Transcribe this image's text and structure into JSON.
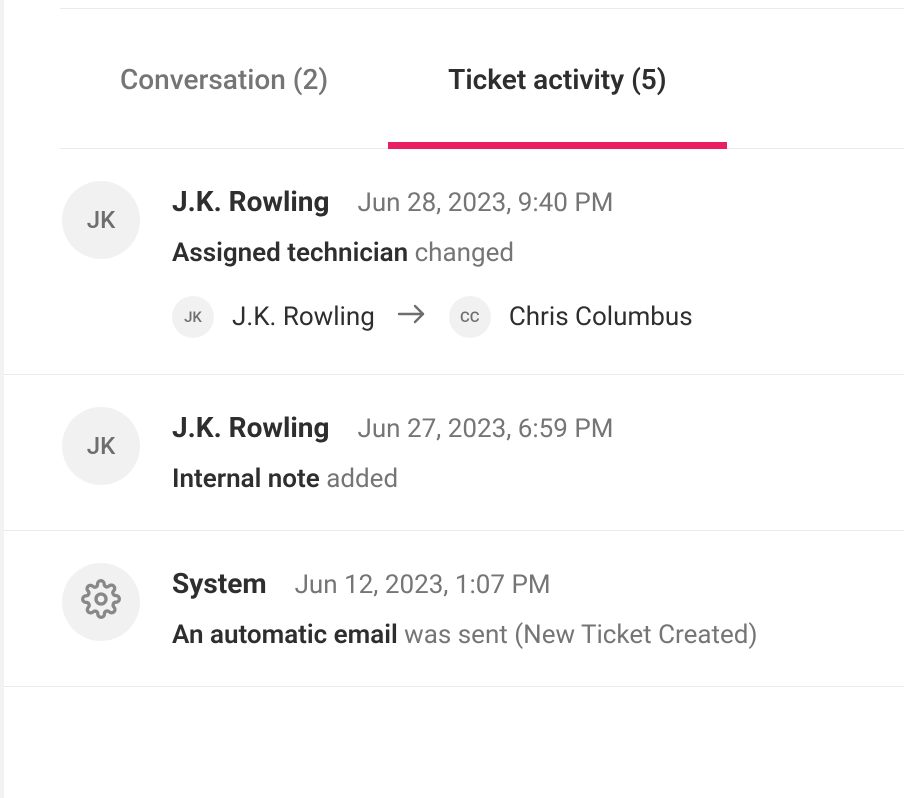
{
  "tabs": {
    "conversation": {
      "label": "Conversation (2)"
    },
    "activity": {
      "label": "Ticket activity (5)"
    }
  },
  "activities": [
    {
      "avatar_initials": "JK",
      "author": "J.K. Rowling",
      "timestamp": "Jun 28, 2023, 9:40 PM",
      "action_strong": "Assigned technician",
      "action_rest": " changed",
      "change": {
        "from_initials": "JK",
        "from_name": "J.K. Rowling",
        "to_initials": "CC",
        "to_name": "Chris Columbus"
      }
    },
    {
      "avatar_initials": "JK",
      "author": "J.K. Rowling",
      "timestamp": "Jun 27, 2023, 6:59 PM",
      "action_strong": "Internal note",
      "action_rest": " added"
    },
    {
      "is_system": true,
      "author": "System",
      "timestamp": "Jun 12, 2023, 1:07 PM",
      "action_strong": "An automatic email",
      "action_rest": " was sent (New Ticket Created)"
    }
  ]
}
